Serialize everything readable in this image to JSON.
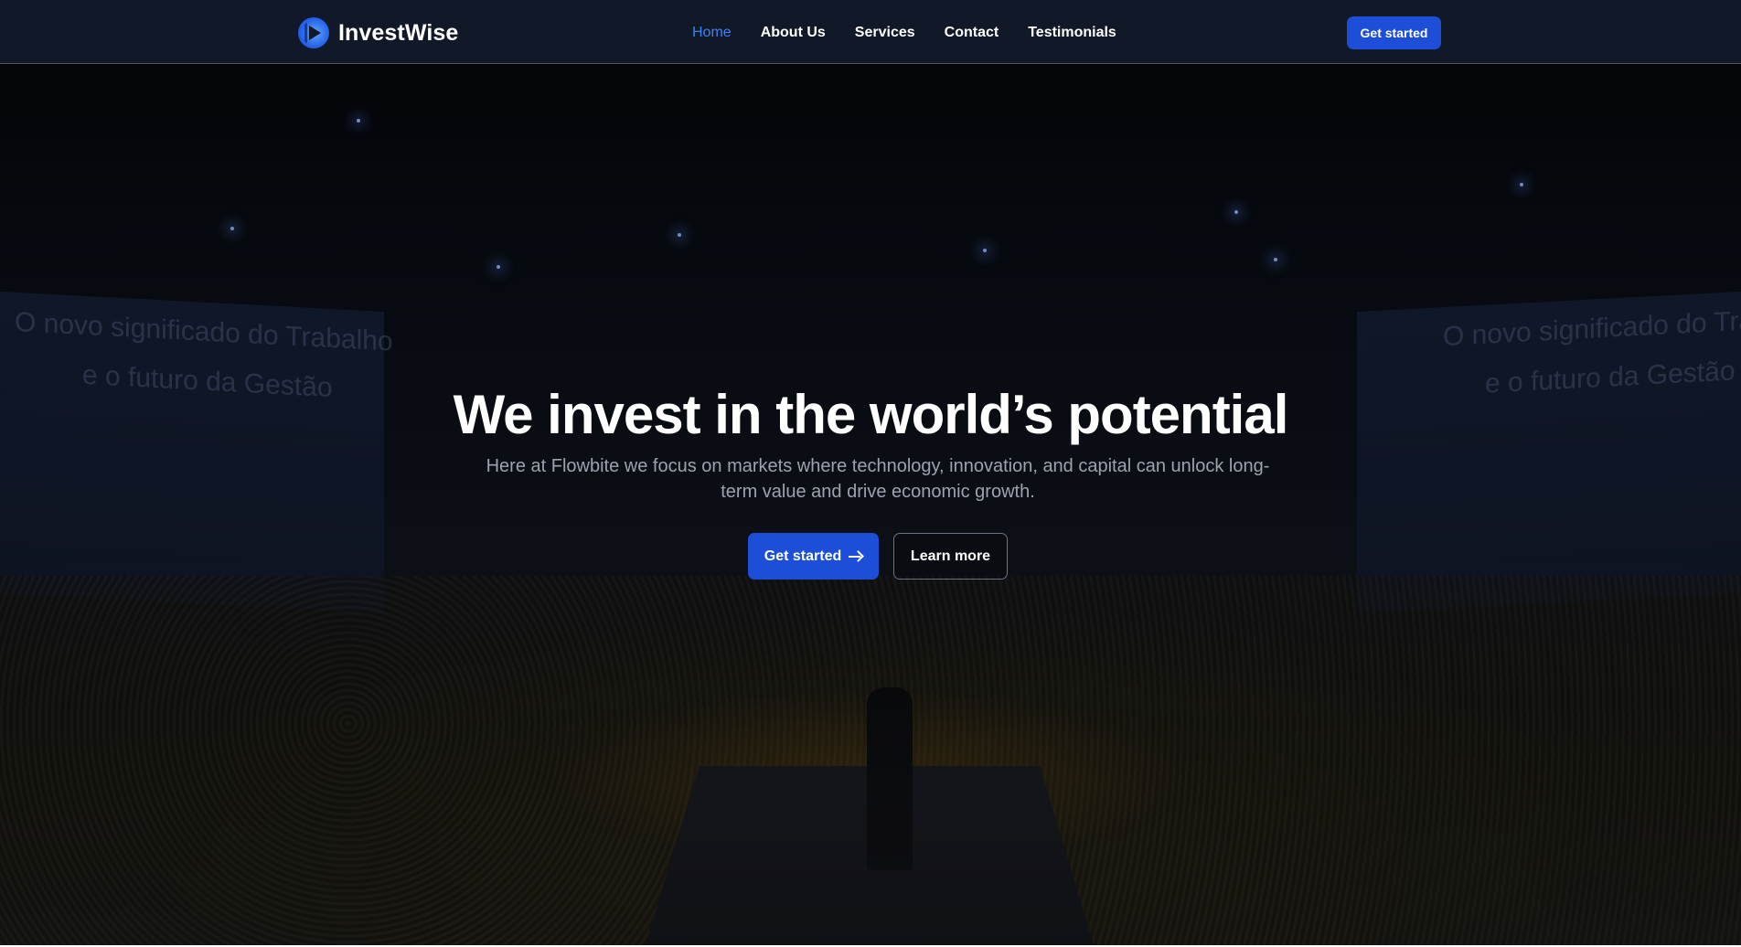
{
  "brand": {
    "name": "InvestWise",
    "logo_icon": "play-circle-logo-icon"
  },
  "nav": {
    "items": [
      {
        "label": "Home",
        "active": true
      },
      {
        "label": "About Us",
        "active": false
      },
      {
        "label": "Services",
        "active": false
      },
      {
        "label": "Contact",
        "active": false
      },
      {
        "label": "Testimonials",
        "active": false
      }
    ],
    "cta_label": "Get started"
  },
  "hero": {
    "title": "We invest in the world’s potential",
    "subtitle": "Here at Flowbite we focus on markets where technology, innovation, and capital can unlock long-term value and drive economic growth.",
    "primary_button": {
      "label": "Get started",
      "icon": "arrow-right-icon"
    },
    "secondary_button": {
      "label": "Learn more"
    },
    "background": {
      "screen_left_lines": [
        "O novo significado do Trabalho",
        "e o futuro da Gestão"
      ],
      "screen_right_lines": [
        "O novo significado do Trabalho",
        "e o futuro da Gestão"
      ]
    }
  },
  "colors": {
    "navbar_bg": "#111827",
    "accent": "#1d4ed8",
    "active_link": "#3b82f6",
    "subtitle_text": "#9ca3af"
  }
}
